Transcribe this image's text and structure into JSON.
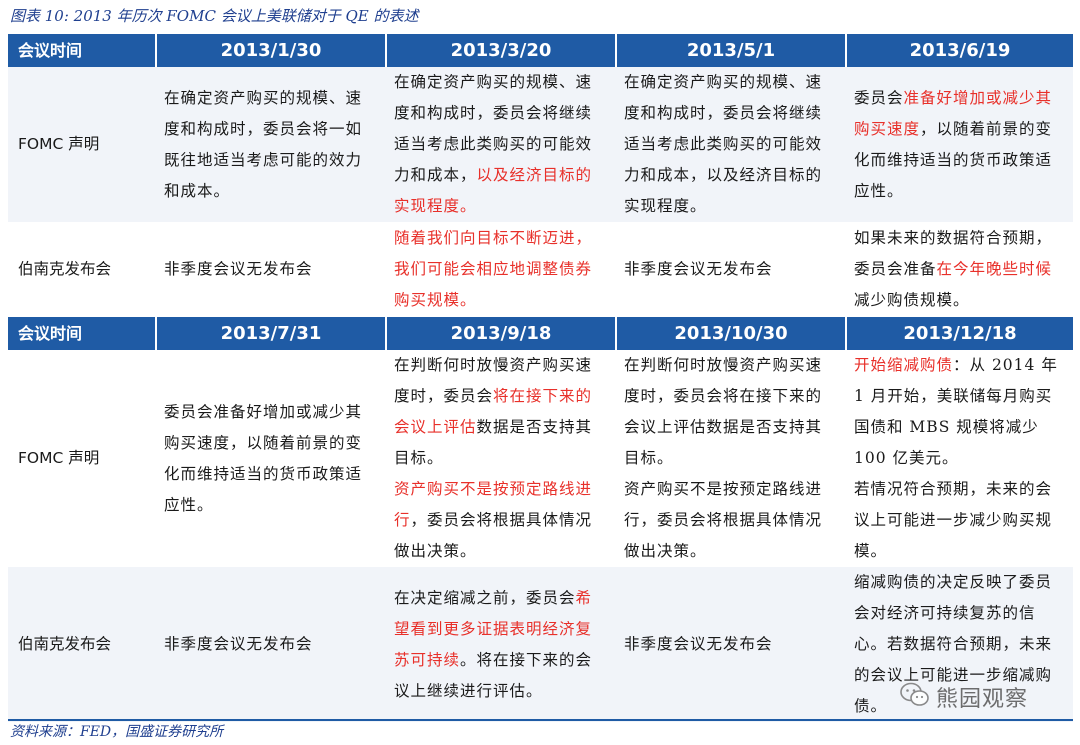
{
  "caption": "图表 10:  2013 年历次 FOMC 会议上美联储对于 QE 的表述",
  "header_label": "会议时间",
  "row_labels": {
    "fomc": "FOMC 声明",
    "bernanke": "伯南克发布会"
  },
  "block1": {
    "dates": [
      "2013/1/30",
      "2013/3/20",
      "2013/5/1",
      "2013/6/19"
    ],
    "fomc": [
      [
        {
          "t": "在确定资产购买的规模、速度和构成时，委员会将一如既往地适当考虑可能的效力和成本。"
        }
      ],
      [
        {
          "t": "在确定资产购买的规模、速度和构成时，委员会将继续适当考虑此类购买的可能效力和成本，"
        },
        {
          "t": "以及经济目标的实现程度。",
          "red": true
        }
      ],
      [
        {
          "t": "在确定资产购买的规模、速度和构成时，委员会将继续适当考虑此类购买的可能效力和成本，以及经济目标的实现程度。"
        }
      ],
      [
        {
          "t": "委员会"
        },
        {
          "t": "准备好增加或减少其购买速度",
          "red": true
        },
        {
          "t": "，以随着前景的变化而维持适当的货币政策适应性。"
        }
      ]
    ],
    "bernanke": [
      [
        {
          "t": "非季度会议无发布会"
        }
      ],
      [
        {
          "t": "随着我们向目标不断迈进，我们可能会相应地调整债券购买规模。",
          "red": true
        }
      ],
      [
        {
          "t": "非季度会议无发布会"
        }
      ],
      [
        {
          "t": "如果未来的数据符合预期，委员会准备"
        },
        {
          "t": "在今年晚些时候",
          "red": true
        },
        {
          "t": "减少购债规模。"
        }
      ]
    ]
  },
  "block2": {
    "dates": [
      "2013/7/31",
      "2013/9/18",
      "2013/10/30",
      "2013/12/18"
    ],
    "fomc": [
      [
        {
          "t": "委员会准备好增加或减少其购买速度，以随着前景的变化而维持适当的货币政策适应性。"
        }
      ],
      [
        {
          "t": "在判断何时放慢资产购买速度时，委员会"
        },
        {
          "t": "将在接下来的会议上评估",
          "red": true
        },
        {
          "t": "数据是否支持其目标。"
        },
        {
          "br": true
        },
        {
          "t": "资产购买不是按预定路线进行",
          "red": true
        },
        {
          "t": "，委员会将根据具体情况做出决策。"
        }
      ],
      [
        {
          "t": "在判断何时放慢资产购买速度时，委员会将在接下来的会议上评估数据是否支持其目标。"
        },
        {
          "br": true
        },
        {
          "t": "资产购买不是按预定路线进行，委员会将根据具体情况做出决策。"
        }
      ],
      [
        {
          "t": "开始缩减购债",
          "red": true
        },
        {
          "t": "：从 2014 年 1 月开始，美联储每月购买国债和 MBS 规模将减少 100 亿美元。"
        },
        {
          "br": true
        },
        {
          "t": "若情况符合预期，未来的会议上可能进一步减少购买规模。"
        }
      ]
    ],
    "bernanke": [
      [
        {
          "t": "非季度会议无发布会"
        }
      ],
      [
        {
          "t": "在决定缩减之前，委员会"
        },
        {
          "t": "希望看到更多证据表明经济复苏可持续",
          "red": true
        },
        {
          "t": "。将在接下来的会议上继续进行评估。"
        }
      ],
      [
        {
          "t": "非季度会议无发布会"
        }
      ],
      [
        {
          "t": "缩减购债的决定反映了委员会对经济可持续复苏的信心。若数据符合预期，未来的会议上可能进一步缩减购债。"
        }
      ]
    ]
  },
  "source": "资料来源：FED，国盛证券研究所",
  "watermark": {
    "icon": "wechat-icon",
    "text": "熊园观察"
  },
  "colors": {
    "header_bg": "#1f5ba5",
    "highlight": "#e8302a",
    "caption": "#1f3f8f"
  }
}
